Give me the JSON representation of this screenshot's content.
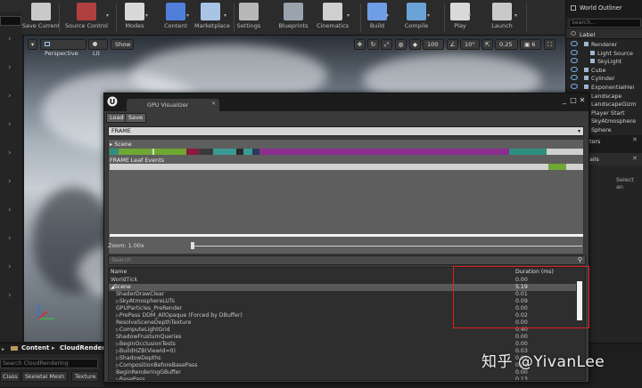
{
  "toolbar": {
    "buttons": [
      {
        "label": "Save Current",
        "icon": "save-icon",
        "color": "#c9c9c9"
      },
      {
        "label": "Source Control",
        "icon": "source-control-icon",
        "color": "#b04040"
      },
      {
        "label": "Modes",
        "icon": "modes-icon",
        "color": "#d8d8d8"
      },
      {
        "label": "Content",
        "icon": "content-icon",
        "color": "#4f7fd9"
      },
      {
        "label": "Marketplace",
        "icon": "marketplace-icon",
        "color": "#aac4e6"
      },
      {
        "label": "Settings",
        "icon": "settings-icon",
        "color": "#b8b8b8"
      },
      {
        "label": "Blueprints",
        "icon": "blueprints-icon",
        "color": "#9aa4ae"
      },
      {
        "label": "Cinematics",
        "icon": "cinematics-icon",
        "color": "#cfcfcf"
      },
      {
        "label": "Build",
        "icon": "build-icon",
        "color": "#6f9ee6"
      },
      {
        "label": "Compile",
        "icon": "compile-icon",
        "color": "#6ba3d6"
      },
      {
        "label": "Play",
        "icon": "play-icon",
        "color": "#d9d9d9"
      },
      {
        "label": "Launch",
        "icon": "launch-icon",
        "color": "#c9c9c9"
      }
    ]
  },
  "viewport": {
    "perspective_label": "Perspective",
    "lit_label": "Lit",
    "show_label": "Show",
    "grid_size": "100",
    "rotation_snap": "10°",
    "scale_snap": "0.25",
    "camera_speed": "6"
  },
  "outliner": {
    "title": "World Outliner",
    "search_placeholder": "Search...",
    "column_label": "Label",
    "items": [
      "Renderer",
      "Light Source",
      "SkyLight",
      "Cube",
      "Cylinder",
      "ExponentialHei",
      "Landscape",
      "LandscapeGizm",
      "Player Start",
      "SkyAtmosphere",
      "Sphere"
    ],
    "tabs_text": [
      "tors",
      "ails"
    ],
    "details_hint": "Select an"
  },
  "content_browser": {
    "tab_label": "Content",
    "breadcrumb_sep": "▸",
    "folder": "CloudRendering",
    "search_placeholder": "Search CloudRendering",
    "filters": [
      "Class",
      "Skeletal Mesh",
      "Texture"
    ]
  },
  "gpu_visualizer": {
    "title": "GPU Visualizer",
    "load_label": "Load",
    "save_label": "Save",
    "frame_selection": "FRAME",
    "scene_label": "Scene",
    "leaf_events_label": "FRAME Leaf Events",
    "zoom_label": "Zoom: 1.00x",
    "search_placeholder": "Search",
    "col_name": "Name",
    "col_duration": "Duration (ms)",
    "rows": [
      {
        "name": "WorldTick",
        "duration": "0.00",
        "indent": 0,
        "expander": ""
      },
      {
        "name": "Scene",
        "duration": "5.19",
        "indent": 0,
        "expander": "◢",
        "selected": true
      },
      {
        "name": "ShaderDrawClear",
        "duration": "0.01",
        "indent": 1,
        "expander": ""
      },
      {
        "name": "SkyAtmosphereLUTs",
        "duration": "0.09",
        "indent": 1,
        "expander": "▷"
      },
      {
        "name": "GPUParticles_PreRender",
        "duration": "0.00",
        "indent": 1,
        "expander": ""
      },
      {
        "name": "PrePass DDM_AllOpaque (Forced by DBuffer)",
        "duration": "0.02",
        "indent": 1,
        "expander": "▷"
      },
      {
        "name": "ResolveSceneDepthTexture",
        "duration": "0.00",
        "indent": 1,
        "expander": ""
      },
      {
        "name": "ComputeLightGrid",
        "duration": "0.40",
        "indent": 1,
        "expander": "▷"
      },
      {
        "name": "ShadowFrustumQueries",
        "duration": "0.00",
        "indent": 1,
        "expander": ""
      },
      {
        "name": "BeginOcclusionTests",
        "duration": "0.00",
        "indent": 1,
        "expander": "▷"
      },
      {
        "name": "BuildHZB(ViewId=0)",
        "duration": "0.03",
        "indent": 1,
        "expander": "▷"
      },
      {
        "name": "ShadowDepths",
        "duration": "0.01",
        "indent": 1,
        "expander": "▷"
      },
      {
        "name": "CompositionBeforeBasePass",
        "duration": "0.01",
        "indent": 1,
        "expander": "▷"
      },
      {
        "name": "BeginRenderingGBuffer",
        "duration": "0.00",
        "indent": 1,
        "expander": ""
      },
      {
        "name": "BasePass",
        "duration": "0.13",
        "indent": 1,
        "expander": "▷"
      }
    ],
    "highlight_color": "#e02020"
  },
  "watermark": "知乎 @YivanLee"
}
